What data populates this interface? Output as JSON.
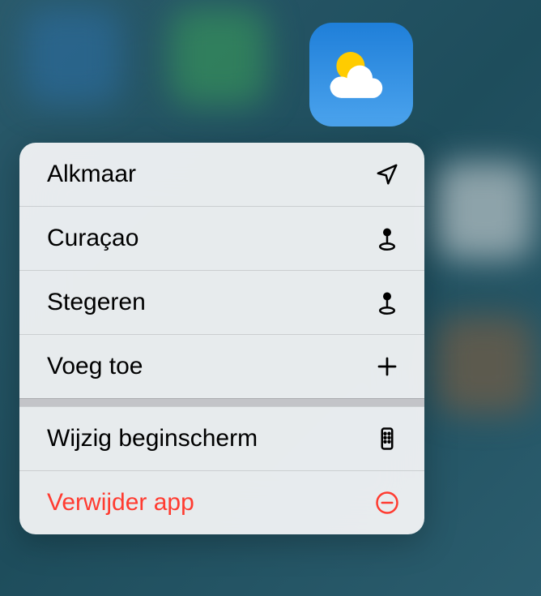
{
  "app": {
    "name": "Weather",
    "icon": "weather-icon"
  },
  "menu": {
    "items": [
      {
        "label": "Alkmaar",
        "icon": "location-arrow-icon",
        "destructive": false
      },
      {
        "label": "Curaçao",
        "icon": "pin-icon",
        "destructive": false
      },
      {
        "label": "Stegeren",
        "icon": "pin-icon",
        "destructive": false
      },
      {
        "label": "Voeg toe",
        "icon": "plus-icon",
        "destructive": false
      }
    ],
    "secondary": [
      {
        "label": "Wijzig beginscherm",
        "icon": "phone-icon",
        "destructive": false
      },
      {
        "label": "Verwijder app",
        "icon": "minus-circle-icon",
        "destructive": true
      }
    ]
  }
}
